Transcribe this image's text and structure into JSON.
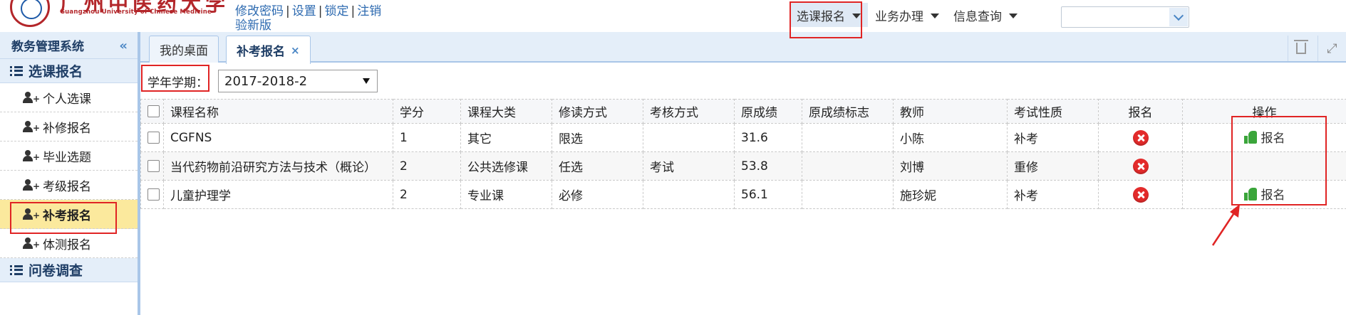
{
  "header": {
    "logo_cn": "广州中医药大学",
    "logo_en": "Guangzhou University of Chinese Medicine",
    "user_links": [
      "修改密码",
      "设置",
      "锁定",
      "注销"
    ],
    "version_link": "验新版",
    "nav": [
      {
        "label": "选课报名"
      },
      {
        "label": "业务办理"
      },
      {
        "label": "信息查询"
      }
    ],
    "search_value": ""
  },
  "sidebar": {
    "title": "教务管理系统",
    "groups": [
      {
        "label": "选课报名"
      },
      {
        "label": "问卷调查"
      }
    ],
    "items": [
      {
        "label": "个人选课"
      },
      {
        "label": "补修报名"
      },
      {
        "label": "毕业选题"
      },
      {
        "label": "考级报名"
      },
      {
        "label": "补考报名"
      },
      {
        "label": "体测报名"
      }
    ]
  },
  "tabs": [
    {
      "label": "我的桌面"
    },
    {
      "label": "补考报名",
      "close": "×"
    }
  ],
  "filter": {
    "label": "学年学期：",
    "value": "2017-2018-2"
  },
  "table": {
    "headers": [
      "课程名称",
      "学分",
      "课程大类",
      "修读方式",
      "考核方式",
      "原成绩",
      "原成绩标志",
      "教师",
      "考试性质",
      "报名",
      "操作"
    ],
    "rows": [
      {
        "course": "CGFNS",
        "credit": "1",
        "category": "其它",
        "mode": "限选",
        "assessment": "",
        "score": "31.6",
        "flag": "",
        "teacher": "小陈",
        "exam_type": "补考",
        "action": "报名"
      },
      {
        "course": "当代药物前沿研究方法与技术（概论）",
        "credit": "2",
        "category": "公共选修课",
        "mode": "任选",
        "assessment": "考试",
        "score": "53.8",
        "flag": "",
        "teacher": "刘博",
        "exam_type": "重修",
        "action": ""
      },
      {
        "course": "儿童护理学",
        "credit": "2",
        "category": "专业课",
        "mode": "必修",
        "assessment": "",
        "score": "56.1",
        "flag": "",
        "teacher": "施珍妮",
        "exam_type": "补考",
        "action": "报名"
      }
    ]
  },
  "colors": {
    "accent": "#a9c6e8",
    "active_menu": "#fbe99d",
    "highlight": "#e02424",
    "status_x": "#e32b2b",
    "thumb": "#3aa53a"
  }
}
